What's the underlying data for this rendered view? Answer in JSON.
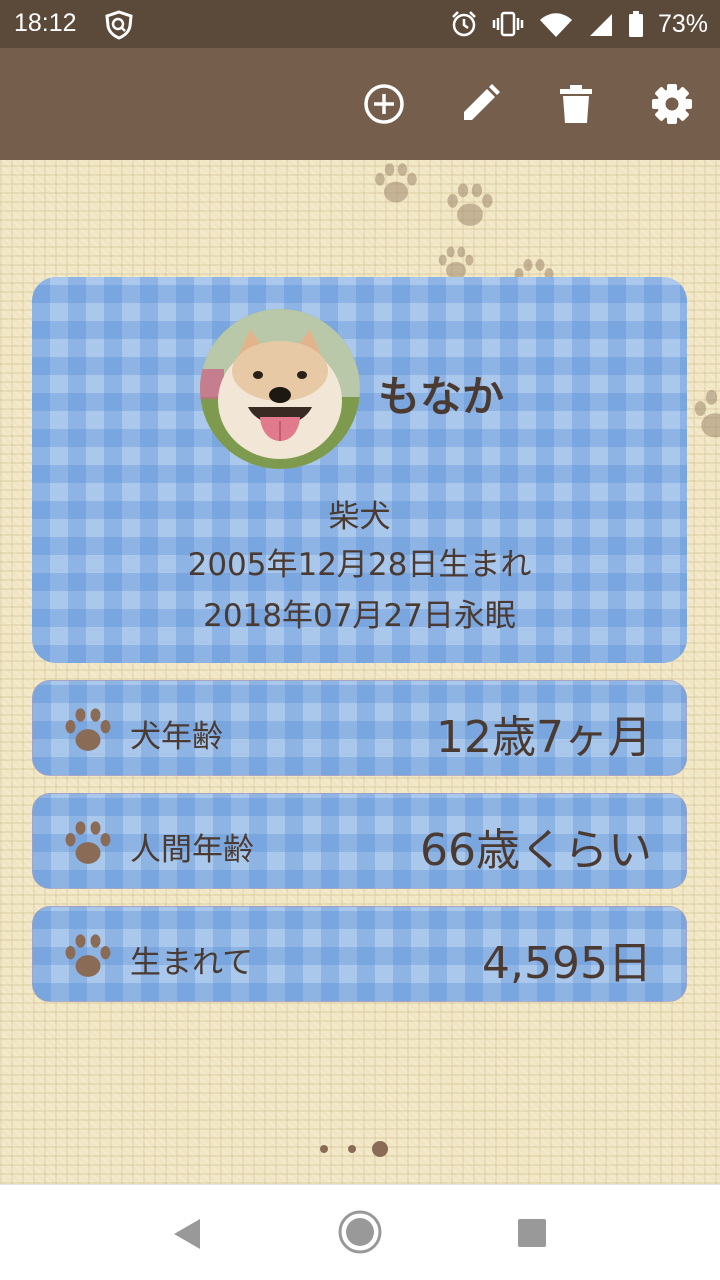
{
  "status_bar": {
    "time": "18:12",
    "battery_percent": "73%",
    "icons": [
      "shield-icon",
      "alarm-icon",
      "vibrate-icon",
      "wifi-icon",
      "signal-icon",
      "battery-icon"
    ]
  },
  "toolbar": {
    "icons": [
      "add-circle-icon",
      "edit-pencil-icon",
      "trash-icon",
      "gear-icon"
    ],
    "background": "#765e4c"
  },
  "profile": {
    "name": "もなか",
    "breed": "柴犬",
    "birth_text": "2005年12月28日生まれ",
    "passed_text": "2018年07月27日永眠"
  },
  "stats": [
    {
      "label": "犬年齢",
      "value": "12歳7ヶ月"
    },
    {
      "label": "人間年齢",
      "value": "66歳くらい"
    },
    {
      "label": "生まれて",
      "value": "4,595日"
    }
  ],
  "pager": {
    "total": 3,
    "current": 3
  },
  "colors": {
    "accent_brown": "#8a6b55",
    "card_blue": "#a9c8ec",
    "text_dark": "#4a3a32"
  }
}
